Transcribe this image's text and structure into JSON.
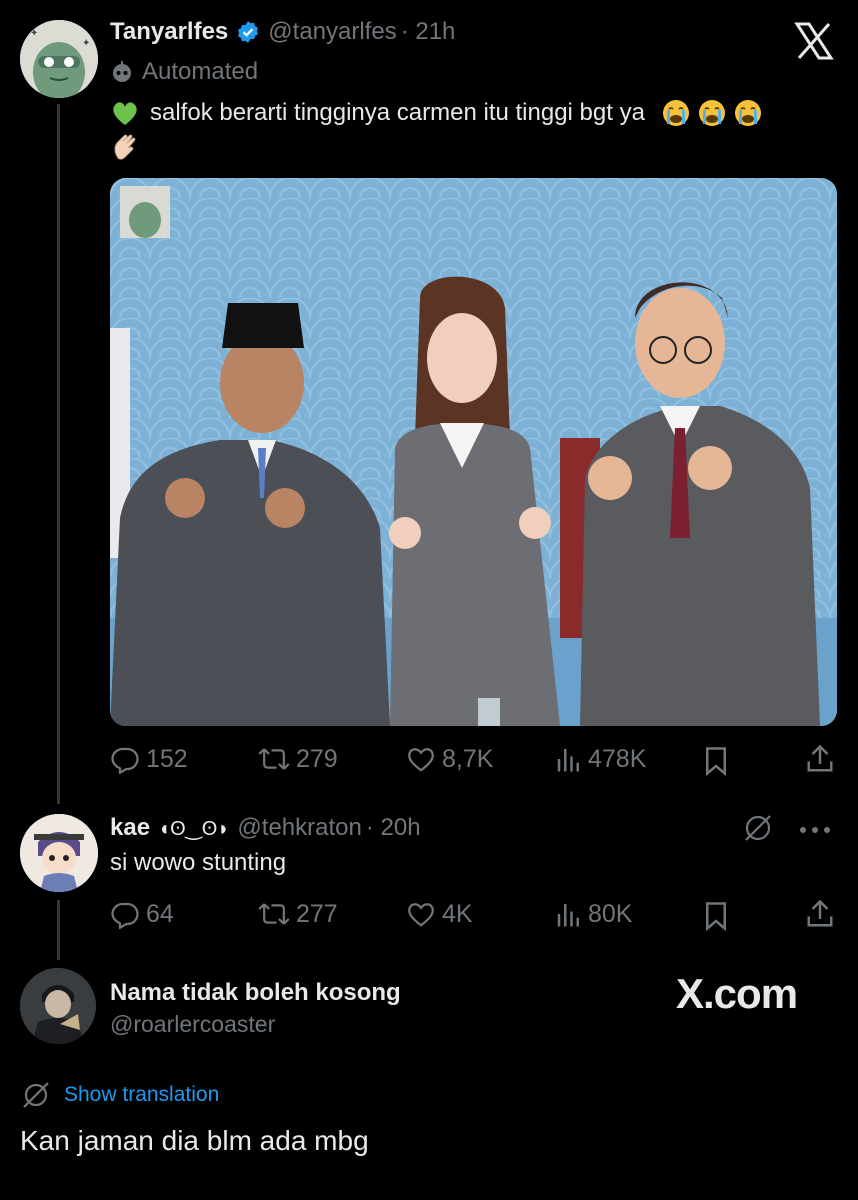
{
  "main_tweet": {
    "display_name": "Tanyarlfes",
    "handle": "@tanyarlfes",
    "time": "· 21h",
    "automated_label": "Automated",
    "text": "salfok berarti tingginya carmen itu tinggi bgt ya",
    "leading_emoji": "green-heart",
    "trailing_emojis": [
      "loudly-crying-face",
      "loudly-crying-face",
      "loudly-crying-face",
      "clapping-hands"
    ],
    "image_description_icon": "photo-of-three-people-making-finger-hearts",
    "stats": {
      "replies": "152",
      "reposts": "279",
      "likes": "8,7K",
      "views": "478K"
    }
  },
  "reply_tweet": {
    "display_name": "kae",
    "name_suffix": "◖ʘ‿ʘ◗",
    "handle": "@tehkraton",
    "time": "· 20h",
    "text": "si wowo stunting",
    "stats": {
      "replies": "64",
      "reposts": "277",
      "likes": "4K",
      "views": "80K"
    }
  },
  "quote_reply": {
    "display_name": "Nama tidak boleh kosong",
    "handle": "@roarlercoaster",
    "translation_label": "Show translation",
    "text": "Kan jaman dia blm ada mbg"
  },
  "watermark": "X.com",
  "close_icon": "x-logo",
  "colors": {
    "background": "#000000",
    "text": "#e7e9ea",
    "muted": "#71767b",
    "link": "#1d9bf0",
    "verified": "#1d9bf0"
  }
}
